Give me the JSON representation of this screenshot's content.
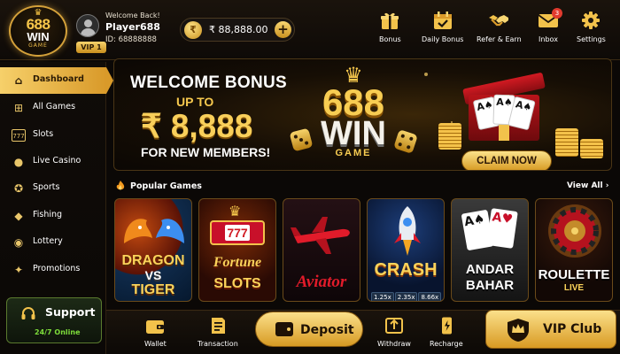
{
  "logo": {
    "number": "688",
    "word": "WIN",
    "sub": "GAME"
  },
  "user": {
    "welcome": "Welcome Back!",
    "name": "Player688",
    "id_text": "ID: 68888888",
    "vip": "VIP 1"
  },
  "balance": {
    "currency_icon": "rupee-coin-icon",
    "amount": "₹ 88,888.00",
    "add_icon": "plus-icon"
  },
  "header_nav": [
    {
      "label": "Bonus",
      "icon": "gift-icon"
    },
    {
      "label": "Daily Bonus",
      "icon": "calendar-check-icon"
    },
    {
      "label": "Refer & Earn",
      "icon": "handshake-icon"
    },
    {
      "label": "Inbox",
      "icon": "envelope-icon",
      "badge": "3"
    },
    {
      "label": "Settings",
      "icon": "gear-icon"
    }
  ],
  "sidebar": {
    "items": [
      {
        "label": "Dashboard",
        "icon": "home-icon",
        "active": true
      },
      {
        "label": "All Games",
        "icon": "gamepad-icon"
      },
      {
        "label": "Slots",
        "icon": "slot-777-icon"
      },
      {
        "label": "Live Casino",
        "icon": "dealer-icon"
      },
      {
        "label": "Sports",
        "icon": "soccer-ball-icon"
      },
      {
        "label": "Fishing",
        "icon": "fish-icon"
      },
      {
        "label": "Lottery",
        "icon": "lottery-ball-icon"
      },
      {
        "label": "Promotions",
        "icon": "megaphone-icon"
      }
    ],
    "support": {
      "title": "Support",
      "subtitle": "24/7 Online",
      "icon": "headset-icon"
    }
  },
  "banner": {
    "line1": "WELCOME BONUS",
    "line2": "UP TO",
    "amount": "₹ 8,888",
    "line3": "FOR NEW MEMBERS!",
    "logo_number": "688",
    "logo_word": "WIN",
    "logo_sub": "GAME",
    "cta": "CLAIM NOW",
    "slides": 5,
    "active_slide": 2
  },
  "popular": {
    "title": "Popular Games",
    "icon": "fire-icon",
    "view_all": "View All",
    "games": [
      {
        "line1": "DRAGON",
        "line2": "VS",
        "line3": "TIGER"
      },
      {
        "line1": "777",
        "line2": "Fortune",
        "line3": "SLOTS"
      },
      {
        "line1": "Aviator"
      },
      {
        "line1": "CRASH",
        "multipliers": [
          "1.25x",
          "2.35x",
          "8.66x"
        ]
      },
      {
        "line1": "ANDAR",
        "line2": "BAHAR"
      },
      {
        "line1": "ROULETTE",
        "line2": "LIVE"
      }
    ]
  },
  "bottom_nav": {
    "wallet": "Wallet",
    "transaction": "Transaction",
    "deposit": "Deposit",
    "withdraw": "Withdraw",
    "recharge": "Recharge",
    "vip_club": "VIP Club"
  },
  "colors": {
    "gold": "#f6c84e",
    "bg": "#0b0806",
    "active": "#e2a93a",
    "support_green": "#7ddc3a",
    "badge_red": "#e23b2e"
  }
}
